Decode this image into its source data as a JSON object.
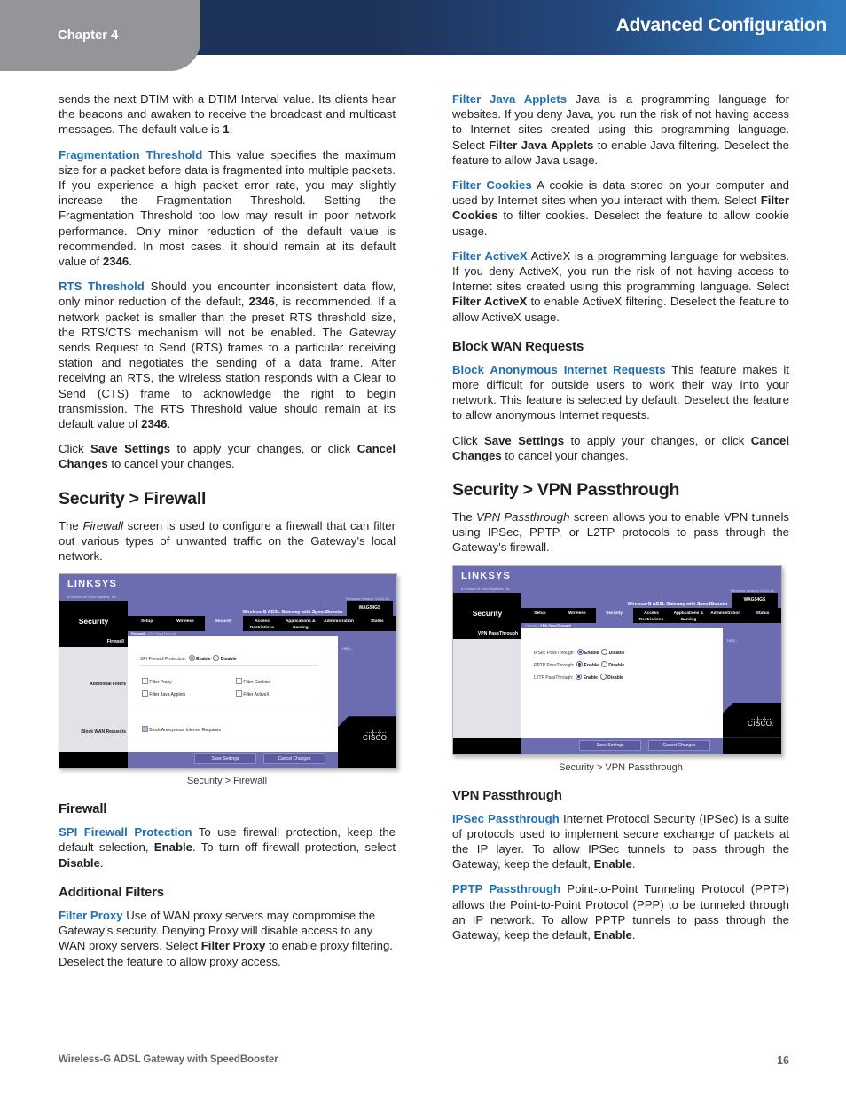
{
  "header": {
    "chapter": "Chapter 4",
    "title": "Advanced Configuration",
    "band_color_left": "#1e3359",
    "band_color_right": "#2e79bd",
    "chapter_tab_color": "#939598"
  },
  "footer": {
    "product": "Wireless-G ADSL Gateway with SpeedBooster",
    "page_number": "16"
  },
  "left_column": {
    "p_dtim_tail": "sends the next DTIM with a DTIM Interval value. Its clients hear the beacons and awaken to receive the broadcast and multicast messages. The default value is ",
    "p_dtim_bold": "1",
    "p_dtim_end": ".",
    "frag_term": "Fragmentation Threshold",
    "frag_body_1": " This value specifies the maximum size for a packet before data is fragmented into multiple packets. If you experience a high packet error rate, you may slightly increase the Fragmentation Threshold. Setting the Fragmentation Threshold too low may result in poor network performance. Only minor reduction of the default value is recommended. In most cases, it should remain at its default value of ",
    "frag_bold_1": "2346",
    "frag_end": ".",
    "rts_term": "RTS Threshold",
    "rts_body_1": " Should you encounter inconsistent data flow, only minor reduction of the default, ",
    "rts_bold_1": "2346",
    "rts_body_2": ", is recommended. If a network packet is smaller than the preset RTS threshold size, the RTS/CTS mechanism will not be enabled. The Gateway sends Request to Send (RTS) frames to a particular receiving station and negotiates the sending of a data frame. After receiving an RTS, the wireless station responds with a Clear to Send (CTS) frame to acknowledge the right to begin transmission. The RTS Threshold value should remain at its default value of ",
    "rts_bold_2": "2346",
    "rts_end": ".",
    "click_pre": "Click ",
    "click_save": "Save Settings",
    "click_mid": " to apply your changes, or click ",
    "click_cancel": "Cancel Changes",
    "click_end": " to cancel your changes.",
    "firewall_section_heading": "Security > Firewall",
    "firewall_intro_pre": "The ",
    "firewall_intro_ital": "Firewall",
    "firewall_intro_post": " screen is used to configure a firewall that can filter out various types of unwanted traffic on the Gateway’s local network.",
    "firewall_caption": "Security > Firewall",
    "firewall_subhead": "Firewall",
    "spi_term": "SPI Firewall Protection",
    "spi_body_1": " To use firewall protection, keep the default selection, ",
    "spi_bold_1": "Enable",
    "spi_body_2": ". To turn off firewall protection, select ",
    "spi_bold_2": "Disable",
    "spi_end": ".",
    "additional_filters_subhead": "Additional Filters",
    "filter_proxy_term": "Filter Proxy",
    "filter_proxy_body_1": "  Use of WAN proxy servers may compromise the Gateway’s security. Denying Proxy will disable access to any WAN proxy servers. Select ",
    "filter_proxy_bold": "Filter Proxy",
    "filter_proxy_body_2": " to enable proxy filtering. Deselect the feature to allow proxy access."
  },
  "right_column": {
    "java_term": "Filter Java Applets",
    "java_body_1": "  Java is a programming language for websites. If you deny Java, you run the risk of not having access to Internet sites created using this programming language. Select ",
    "java_bold": "Filter Java Applets",
    "java_body_2": " to enable Java filtering. Deselect the feature to allow Java usage.",
    "cookies_term": "Filter Cookies",
    "cookies_body_1": "  A cookie is data stored on your computer and used by Internet sites when you interact with them. Select ",
    "cookies_bold": "Filter Cookies",
    "cookies_body_2": " to filter cookies. Deselect the feature to allow cookie usage.",
    "activex_term": "Filter ActiveX",
    "activex_body_1": "  ActiveX is a programming language for websites. If you deny ActiveX, you run the risk of not having access to Internet sites created using this programming language. Select ",
    "activex_bold": "Filter ActiveX",
    "activex_body_2": " to enable ActiveX filtering. Deselect the feature to allow ActiveX usage.",
    "block_wan_subhead": "Block WAN Requests",
    "block_term": "Block Anonymous Internet Requests",
    "block_body": " This feature makes it more difficult for outside users to work their way into your network. This feature is selected by default. Deselect the feature to allow anonymous Internet requests.",
    "click_pre": "Click ",
    "click_save": "Save Settings",
    "click_mid": " to apply your changes, or click ",
    "click_cancel": "Cancel Changes",
    "click_end": " to cancel your changes.",
    "vpn_section_heading": "Security > VPN Passthrough",
    "vpn_intro_pre": "The ",
    "vpn_intro_ital": "VPN Passthrough",
    "vpn_intro_post": " screen allows you to enable VPN tunnels using IPSec, PPTP, or L2TP protocols to pass through the Gateway’s firewall.",
    "vpn_caption": "Security > VPN Passthrough",
    "vpn_subhead": "VPN Passthrough",
    "ipsec_term": "IPSec Passthrough",
    "ipsec_body_1": "  Internet Protocol Security (IPSec) is a suite of protocols used to implement secure exchange of packets at the IP layer. To allow IPSec tunnels to pass through the Gateway, keep the default, ",
    "ipsec_bold": "Enable",
    "ipsec_end": ".",
    "pptp_term": "PPTP Passthrough",
    "pptp_body_1": " Point-to-Point Tunneling Protocol (PPTP) allows the Point-to-Point Protocol (PPP) to be tunneled through an IP network. To allow PPTP tunnels to pass through the Gateway, keep the default, ",
    "pptp_bold": "Enable",
    "pptp_end": "."
  },
  "firewall_screenshot": {
    "brand": "LINKSYS",
    "brand_sub": "A Division of Cisco Systems, Inc.",
    "firmware": "Firmware Version: V1.01.30",
    "product_name": "Wireless-G ADSL Gateway with SpeedBooster",
    "model": "WAG54GS",
    "section_name": "Security",
    "tabs": [
      "Setup",
      "Wireless",
      "Security",
      "Access\nRestrictions",
      "Applications &\nGaming",
      "Administration",
      "Status"
    ],
    "active_tab": "Security",
    "subtabs": [
      "Firewall",
      "VPN PassThrough"
    ],
    "active_subtab": "Firewall",
    "panel_header": "Firewall",
    "row_labels": [
      "Additional Filters",
      "Block WAN Requests"
    ],
    "spi_label": "SPI Firewall Protection:",
    "spi_enable": "Enable",
    "spi_disable": "Disable",
    "checkboxes": [
      "Filter Proxy",
      "Filter Cookies",
      "Filter Java Applets",
      "Filter ActiveX"
    ],
    "block_checkbox": "Block Anonymous Internet Requests",
    "help_label": "Help...",
    "save_button": "Save Settings",
    "cancel_button": "Cancel Changes",
    "cisco_text": "CISCO."
  },
  "vpn_screenshot": {
    "brand": "LINKSYS",
    "brand_sub": "A Division of Cisco Systems, Inc.",
    "firmware": "Firmware Version: V1.01.30",
    "product_name": "Wireless-G ADSL Gateway with SpeedBooster",
    "model": "WAG54GS",
    "section_name": "Security",
    "tabs": [
      "Setup",
      "Wireless",
      "Security",
      "Access\nRestrictions",
      "Applications &\nGaming",
      "Administration",
      "Status"
    ],
    "active_tab": "Security",
    "subtabs": [
      "Firewall",
      "VPN PassThrough"
    ],
    "active_subtab": "VPN PassThrough",
    "panel_header": "VPN PassThrough",
    "rows": [
      {
        "label": "IPSec PassThrough:",
        "enable": "Enable",
        "disable": "Disable"
      },
      {
        "label": "PPTP PassThrough:",
        "enable": "Enable",
        "disable": "Disable"
      },
      {
        "label": "L2TP PassThrough:",
        "enable": "Enable",
        "disable": "Disable"
      }
    ],
    "help_label": "Help...",
    "save_button": "Save Settings",
    "cancel_button": "Cancel Changes",
    "cisco_text": "CISCO."
  }
}
